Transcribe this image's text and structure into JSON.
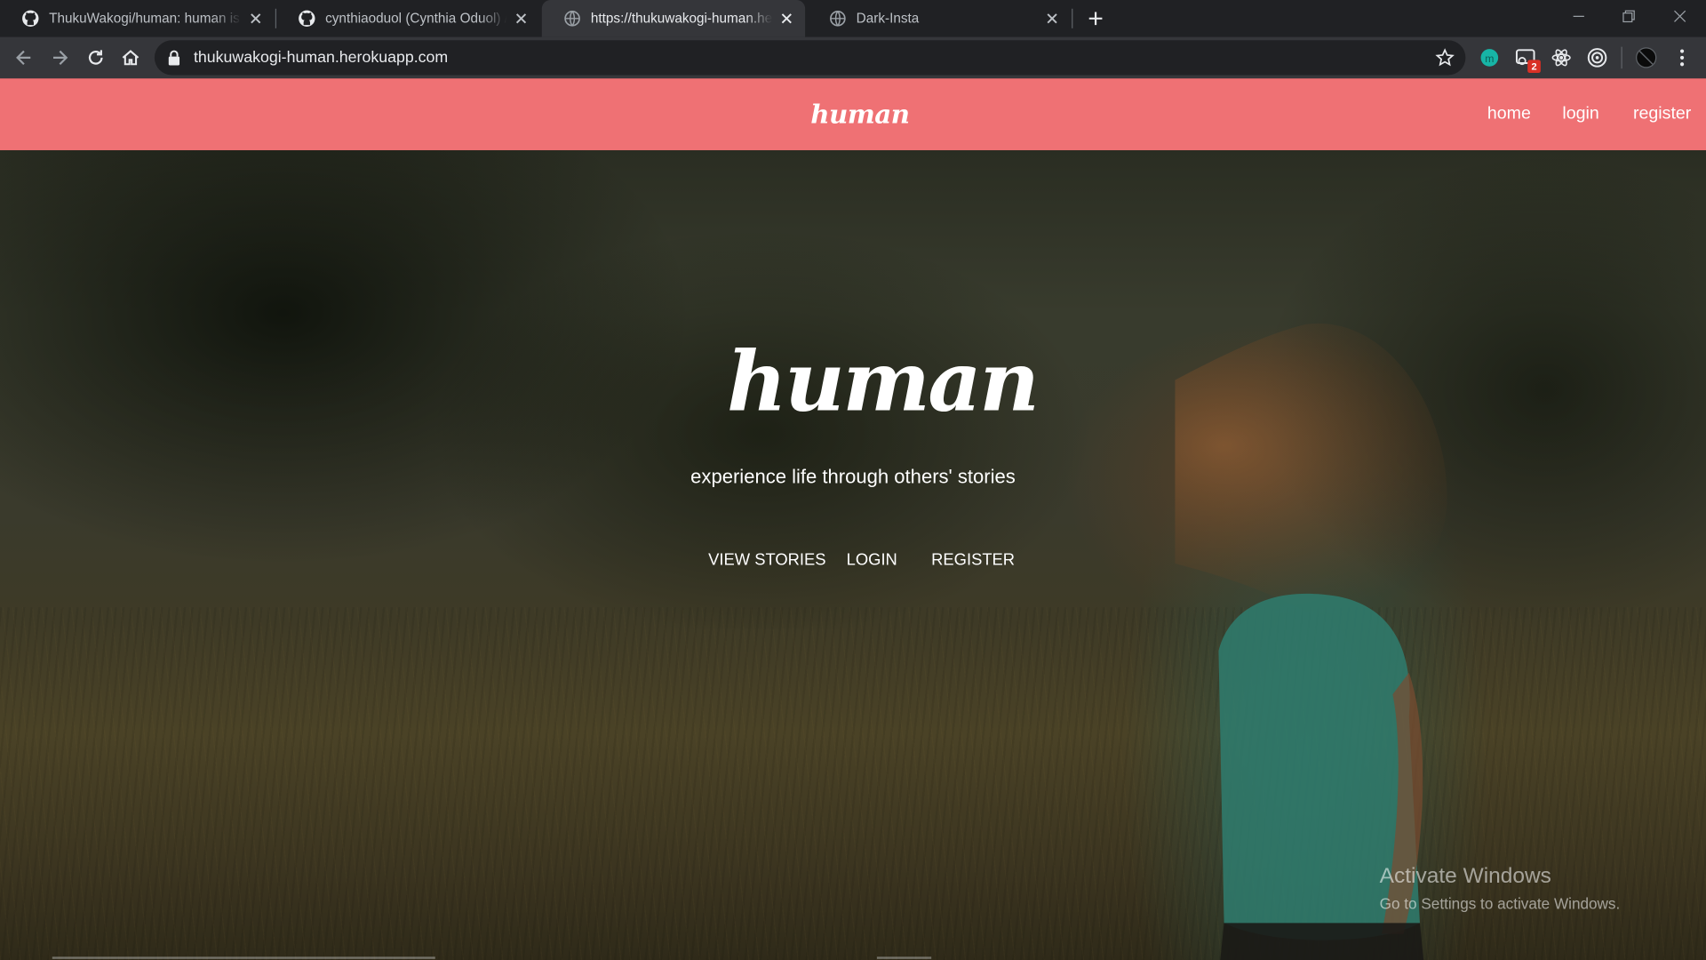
{
  "browser": {
    "tabs": [
      {
        "title": "ThukuWakogi/human: human is a",
        "icon": "github-icon"
      },
      {
        "title": "cynthiaoduol (Cynthia Oduol) / R",
        "icon": "github-icon"
      },
      {
        "title": "https://thukuwakogi-human.heroku",
        "icon": "globe-icon"
      },
      {
        "title": "Dark-Insta",
        "icon": "globe-icon"
      }
    ],
    "active_tab_index": 2,
    "url": "thukuwakogi-human.herokuapp.com",
    "extension_badge": "2"
  },
  "site": {
    "brand": "human",
    "nav": {
      "home": "home",
      "login": "login",
      "register": "register"
    },
    "hero": {
      "title": "human",
      "subtitle": "experience life through others' stories",
      "buttons": {
        "view_stories": "VIEW STORIES",
        "login": "LOGIN",
        "register": "REGISTER"
      }
    }
  },
  "os_watermark": {
    "title": "Activate Windows",
    "subtitle": "Go to Settings to activate Windows."
  },
  "colors": {
    "navbar": "#ef7174",
    "tabstrip": "#202124",
    "toolbar": "#35363a"
  }
}
